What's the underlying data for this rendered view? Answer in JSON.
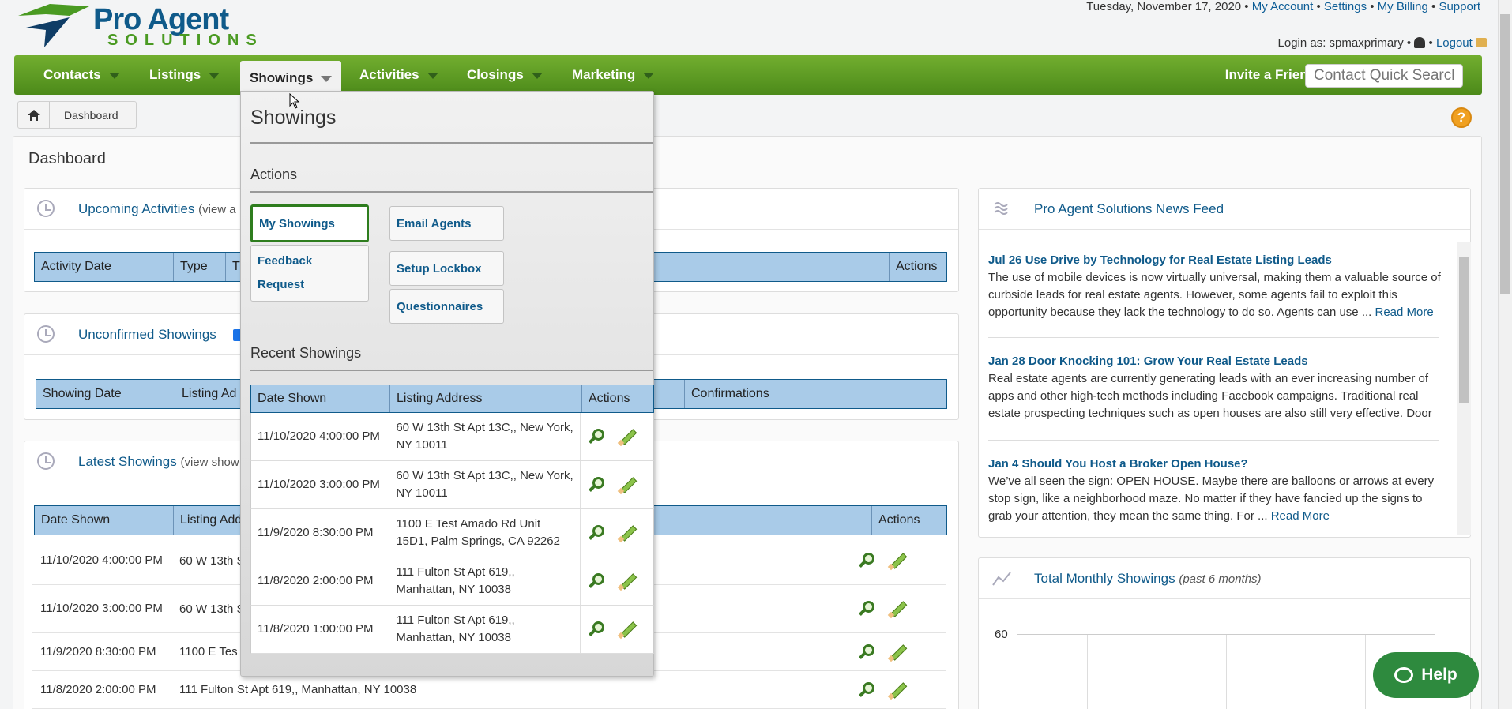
{
  "header": {
    "logo_line1": "Pro Agent",
    "logo_line2": "SOLUTIONS",
    "date": "Tuesday, November 17, 2020",
    "links": [
      "My Account",
      "Settings",
      "My Billing",
      "Support"
    ],
    "login_prefix": "Login as: spmaxprimary",
    "logout": "Logout"
  },
  "nav": {
    "items": [
      "Contacts",
      "Listings",
      "Showings",
      "Activities",
      "Closings",
      "Marketing"
    ],
    "active": "Showings",
    "invite": "Invite a Friend",
    "search_placeholder": "Contact Quick Search"
  },
  "breadcrumb": {
    "current": "Dashboard"
  },
  "dashboard": {
    "title": "Dashboard",
    "upcoming": {
      "title": "Upcoming Activities",
      "subtitle": "(view a",
      "columns": [
        "Activity Date",
        "Type",
        "Ti",
        "Actions"
      ]
    },
    "unconfirmed": {
      "title": "Unconfirmed Showings",
      "columns": [
        "Showing Date",
        "Listing Ad",
        "Confirmations"
      ]
    },
    "latest": {
      "title": "Latest Showings",
      "subtitle": "(view show",
      "columns": [
        "Date Shown",
        "Listing Add",
        "Actions"
      ],
      "rows": [
        {
          "date": "11/10/2020 4:00:00 PM",
          "address": "60 W 13th S"
        },
        {
          "date": "11/10/2020 3:00:00 PM",
          "address": "60 W 13th S"
        },
        {
          "date": "11/9/2020 8:30:00 PM",
          "address": "1100 E Tes"
        },
        {
          "date": "11/8/2020 2:00:00 PM",
          "address": "111 Fulton St Apt 619,, Manhattan, NY 10038"
        }
      ]
    },
    "news": {
      "title": "Pro Agent Solutions News Feed",
      "items": [
        {
          "title": "Jul 26 Use Drive by Technology for Real Estate Listing Leads",
          "body": "The use of mobile devices is now virtually universal, making them a valuable source of curbside leads for real estate agents. However, some agents fail to exploit this opportunity because they lack the technology to do so. Agents can use ...",
          "more": "Read More"
        },
        {
          "title": "Jan 28 Door Knocking 101: Grow Your Real Estate Leads",
          "body": "Real estate agents are currently generating leads with an ever increasing number of apps and other high-tech methods including Facebook campaigns. Traditional real estate prospecting techniques such as open houses are also still very effective. Door",
          "more": ""
        },
        {
          "title": "Jan 4 Should You Host a Broker Open House?",
          "body": "We’ve all seen the sign: OPEN HOUSE. Maybe there are balloons or arrows at every stop sign, like a neighborhood maze. No matter if they have fancied up the signs to grab your attention, they mean the same thing. For ...",
          "more": "Read More"
        }
      ]
    },
    "monthly": {
      "title": "Total Monthly Showings",
      "subtitle": "(past 6 months)",
      "y_tick": "60"
    }
  },
  "dropdown": {
    "title": "Showings",
    "actions_label": "Actions",
    "buttons": [
      "My Showings",
      "Email Agents",
      "Feedback Request",
      "Setup Lockbox",
      "Questionnaires"
    ],
    "recent_label": "Recent Showings",
    "columns": [
      "Date Shown",
      "Listing Address",
      "Actions"
    ],
    "rows": [
      {
        "date": "11/10/2020 4:00:00 PM",
        "address": "60 W 13th St Apt 13C,, New York, NY 10011"
      },
      {
        "date": "11/10/2020 3:00:00 PM",
        "address": "60 W 13th St Apt 13C,, New York, NY 10011"
      },
      {
        "date": "11/9/2020 8:30:00 PM",
        "address": "1100 E Test Amado Rd Unit 15D1, Palm Springs, CA 92262"
      },
      {
        "date": "11/8/2020 2:00:00 PM",
        "address": "111 Fulton St Apt 619,, Manhattan, NY 10038"
      },
      {
        "date": "11/8/2020 1:00:00 PM",
        "address": "111 Fulton St Apt 619,, Manhattan, NY 10038"
      }
    ]
  },
  "help_button": "Help",
  "colors": {
    "nav_green": "#5a9a22",
    "link_blue": "#0f5a8a",
    "header_blue": "#a9cbe8",
    "help_green": "#2e8a3e"
  }
}
